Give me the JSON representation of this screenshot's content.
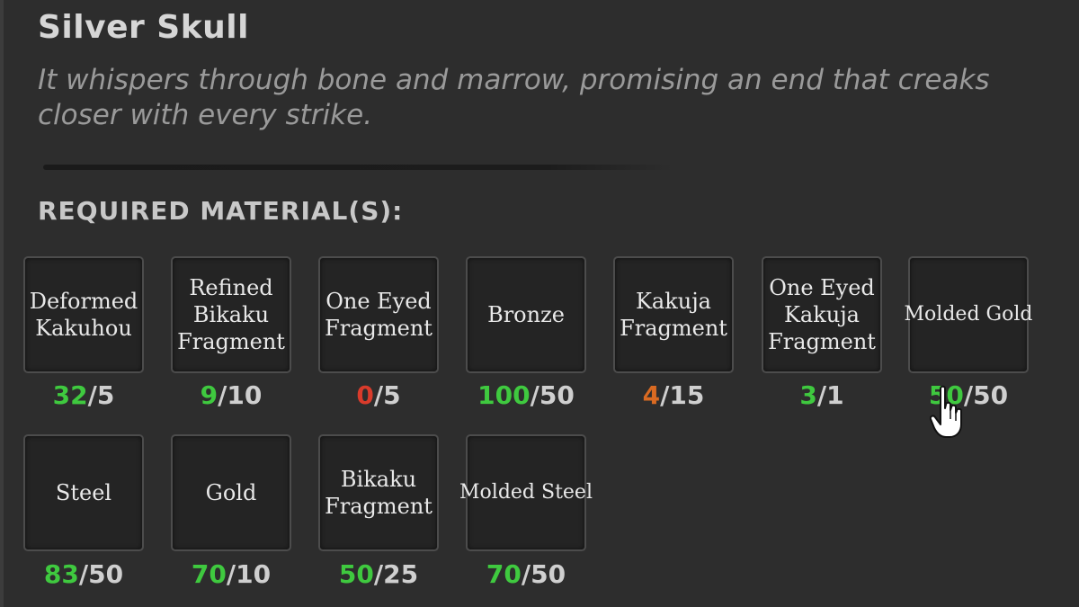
{
  "item": {
    "title": "Silver Skull",
    "description": "It whispers through bone and marrow, promising an end that creaks closer with every strike."
  },
  "required_heading": "REQUIRED MATERIAL(S):",
  "materials": [
    {
      "name": "Deformed Kakuhou",
      "have": "32",
      "need": "/5",
      "status_color": "#3fc93f"
    },
    {
      "name": "Refined Bikaku Fragment",
      "have": "9",
      "need": "/10",
      "status_color": "#3fc93f"
    },
    {
      "name": "One Eyed Fragment",
      "have": "0",
      "need": "/5",
      "status_color": "#d93b2b"
    },
    {
      "name": "Bronze",
      "have": "100",
      "need": "/50",
      "status_color": "#3fc93f"
    },
    {
      "name": "Kakuja Fragment",
      "have": "4",
      "need": "/15",
      "status_color": "#d96a22"
    },
    {
      "name": "One Eyed Kakuja Fragment",
      "have": "3",
      "need": "/1",
      "status_color": "#3fc93f"
    },
    {
      "name": "Molded Gold",
      "have": "50",
      "need": "/50",
      "status_color": "#3fc93f"
    },
    {
      "name": "Steel",
      "have": "83",
      "need": "/50",
      "status_color": "#3fc93f"
    },
    {
      "name": "Gold",
      "have": "70",
      "need": "/10",
      "status_color": "#3fc93f"
    },
    {
      "name": "Bikaku Fragment",
      "have": "50",
      "need": "/25",
      "status_color": "#3fc93f"
    },
    {
      "name": "Molded Steel",
      "have": "70",
      "need": "/50",
      "status_color": "#3fc93f"
    }
  ],
  "icons": {
    "cursor": "hand-pointer-icon"
  }
}
